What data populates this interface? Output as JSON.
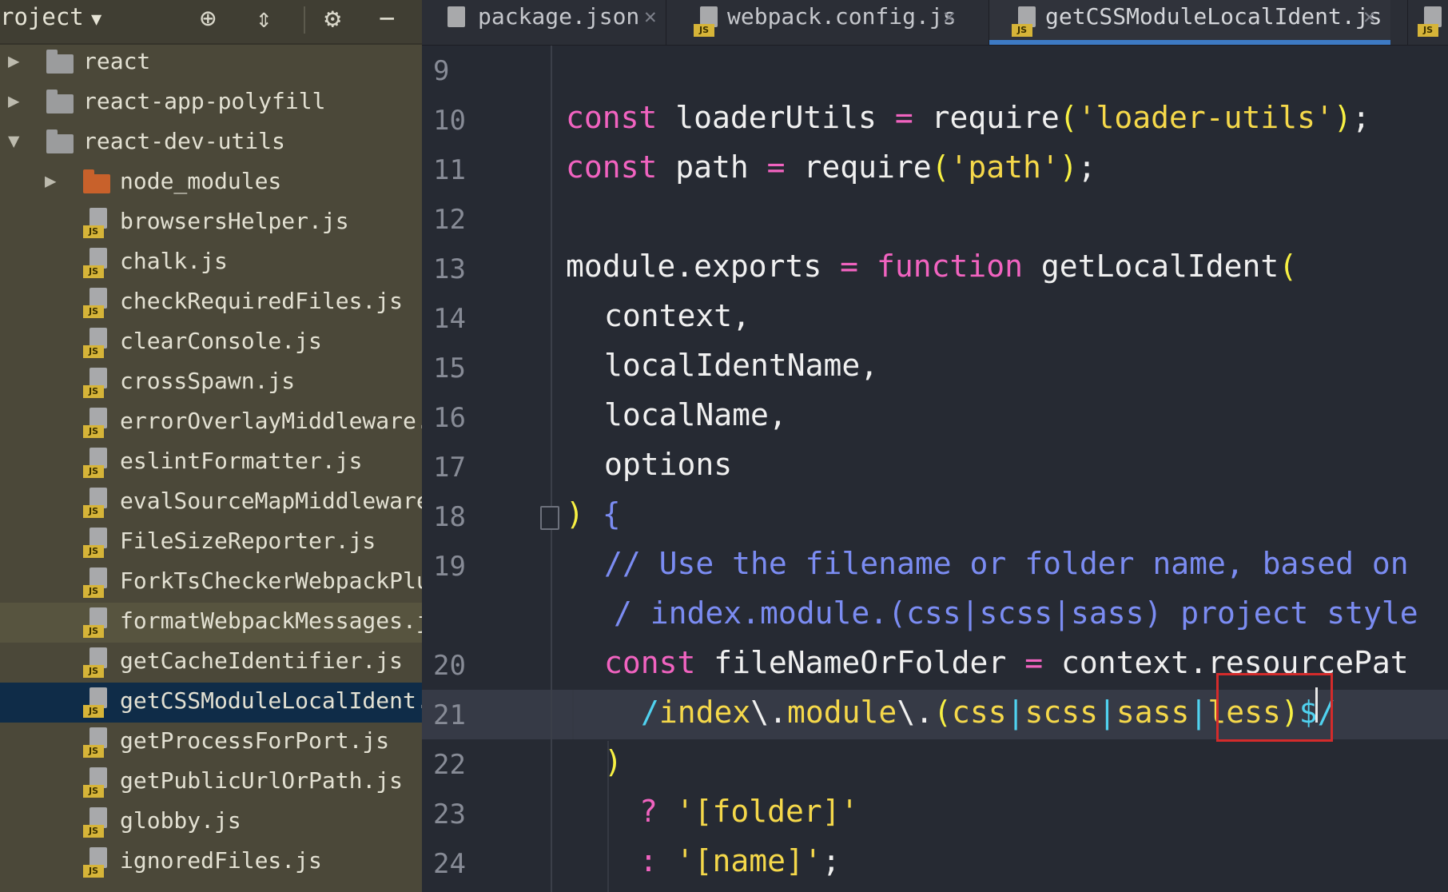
{
  "sidebar": {
    "header": {
      "title": "roject",
      "icons": [
        "crosshair-icon",
        "collapse-icon",
        "gear-icon",
        "minimize-icon"
      ]
    },
    "items": [
      {
        "label": "react",
        "type": "folder",
        "expanded": false
      },
      {
        "label": "react-app-polyfill",
        "type": "folder",
        "expanded": false
      },
      {
        "label": "react-dev-utils",
        "type": "folder",
        "expanded": true
      },
      {
        "label": "node_modules",
        "type": "folder-excluded",
        "expanded": false
      },
      {
        "label": "browsersHelper.js",
        "type": "js"
      },
      {
        "label": "chalk.js",
        "type": "js"
      },
      {
        "label": "checkRequiredFiles.js",
        "type": "js"
      },
      {
        "label": "clearConsole.js",
        "type": "js"
      },
      {
        "label": "crossSpawn.js",
        "type": "js"
      },
      {
        "label": "errorOverlayMiddleware.j",
        "type": "js"
      },
      {
        "label": "eslintFormatter.js",
        "type": "js"
      },
      {
        "label": "evalSourceMapMiddleware.",
        "type": "js"
      },
      {
        "label": "FileSizeReporter.js",
        "type": "js"
      },
      {
        "label": "ForkTsCheckerWebpackPlug",
        "type": "js"
      },
      {
        "label": "formatWebpackMessages.js",
        "type": "js"
      },
      {
        "label": "getCacheIdentifier.js",
        "type": "js"
      },
      {
        "label": "getCSSModuleLocalIdent.j",
        "type": "js",
        "selected": true
      },
      {
        "label": "getProcessForPort.js",
        "type": "js"
      },
      {
        "label": "getPublicUrlOrPath.js",
        "type": "js"
      },
      {
        "label": "globby.js",
        "type": "js"
      },
      {
        "label": "ignoredFiles.js",
        "type": "js"
      }
    ]
  },
  "tabs": [
    {
      "label": "package.json",
      "active": false,
      "icon": "json-file-icon"
    },
    {
      "label": "webpack.config.js",
      "active": false,
      "icon": "js-file-icon"
    },
    {
      "label": "getCSSModuleLocalIdent.js",
      "active": true,
      "icon": "js-file-icon"
    }
  ],
  "tab_close_glyph": "✕",
  "js_badge": "JS",
  "editor": {
    "line_numbers": [
      "9",
      "10",
      "11",
      "12",
      "13",
      "14",
      "15",
      "16",
      "17",
      "18",
      "19",
      "20",
      "21",
      "22",
      "23",
      "24"
    ],
    "lines": {
      "l10": {
        "kw": "const",
        "a": " loaderUtils ",
        "op": "=",
        "b": " require",
        "p1": "(",
        "s": "'loader-utils'",
        "p2": ")",
        "end": ";"
      },
      "l11": {
        "kw": "const",
        "a": " path ",
        "op": "=",
        "b": " require",
        "p1": "(",
        "s": "'path'",
        "p2": ")",
        "end": ";"
      },
      "l13": {
        "a": "module.exports ",
        "op": "=",
        "kw": " function",
        "b": " getLocalIdent",
        "p1": "("
      },
      "l14": "context,",
      "l15": "localIdentName,",
      "l16": "localName,",
      "l17": "options",
      "l18": {
        "p2": ")",
        "brace": " {"
      },
      "l19a": "// Use the filename or folder name, based on",
      "l19b": "/ index.module.(css|scss|sass) project style",
      "l20": {
        "kw": "const",
        "a": " fileNameOrFolder ",
        "op": "=",
        "b": " context.resourcePat"
      },
      "l21": {
        "slash": "/",
        "t1": "index",
        "esc1": "\\.",
        "t2": "module",
        "esc2": "\\.",
        "p1": "(",
        "alt1": "css",
        "pipe": "|",
        "alt2": "scss",
        "alt3": "sass",
        "alt4": "less",
        "p2": ")",
        "tail": "$/"
      },
      "l22": ")",
      "l23": {
        "op": "?",
        "s": " '[folder]'"
      },
      "l24": {
        "op": ":",
        "s": " '[name]'",
        "end": ";"
      }
    }
  }
}
